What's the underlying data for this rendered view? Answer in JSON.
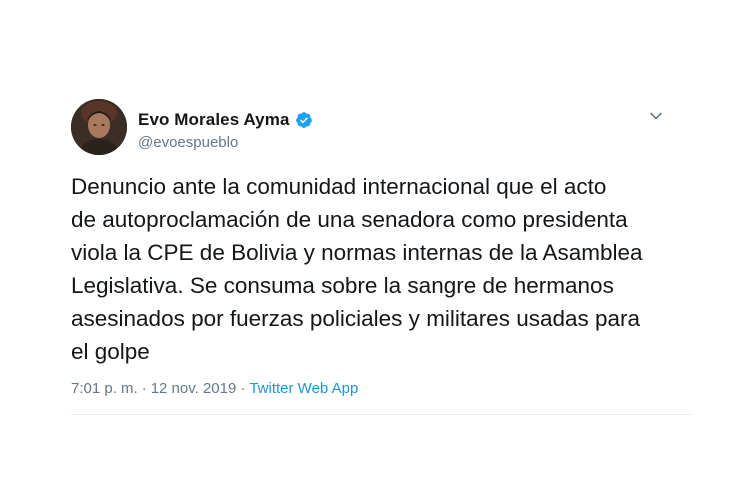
{
  "author": {
    "display_name": "Evo Morales Ayma",
    "handle": "@evoespueblo",
    "verified": true
  },
  "tweet": {
    "text": "Denuncio ante la comunidad internacional que el acto\nde autoproclamación de una senadora como presidenta\nviola la CPE de Bolivia y normas internas de la Asamblea\nLegislativa. Se consuma sobre la sangre de hermanos\nasesinados por fuerzas policiales y militares usadas para\nel golpe",
    "time": "7:01 p. m.",
    "separator": "·",
    "date": "12 nov. 2019",
    "source": "Twitter Web App"
  },
  "colors": {
    "text": "#14171a",
    "secondary": "#657786",
    "accent": "#1b95e0",
    "verified_badge": "#1da1f2"
  },
  "icons": {
    "verified": "verified-badge-icon",
    "menu": "chevron-down-icon"
  }
}
